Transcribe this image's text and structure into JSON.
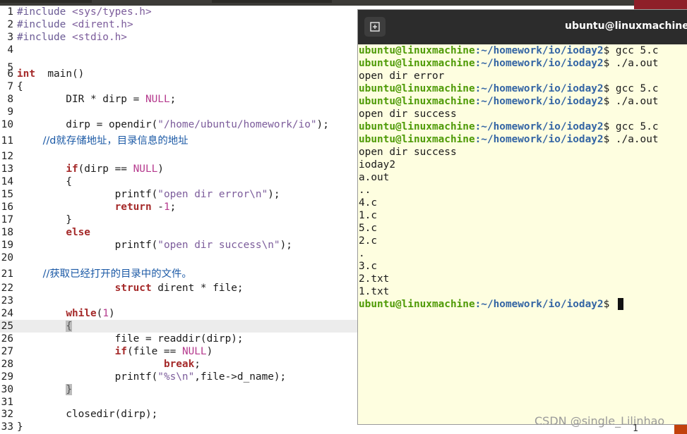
{
  "editor": {
    "lines": [
      {
        "n": "1",
        "parts": [
          [
            "pp",
            "#include "
          ],
          [
            "str",
            "<sys/types.h>"
          ]
        ]
      },
      {
        "n": "2",
        "parts": [
          [
            "pp",
            "#include "
          ],
          [
            "str",
            "<dirent.h>"
          ]
        ]
      },
      {
        "n": "3",
        "parts": [
          [
            "pp",
            "#include "
          ],
          [
            "str",
            "<stdio.h>"
          ]
        ]
      },
      {
        "n": "4",
        "parts": []
      },
      {
        "n": "5",
        "parts": []
      },
      {
        "n": "6",
        "parts": [
          [
            "kw",
            "int"
          ],
          [
            "",
            "  main()"
          ]
        ]
      },
      {
        "n": "7",
        "parts": [
          [
            "",
            "{"
          ]
        ]
      },
      {
        "n": "8",
        "parts": [
          [
            "",
            "        DIR * dirp = "
          ],
          [
            "num",
            "NULL"
          ],
          [
            "",
            ";"
          ]
        ]
      },
      {
        "n": "9",
        "parts": []
      },
      {
        "n": "10",
        "parts": [
          [
            "",
            "        dirp = opendir("
          ],
          [
            "str",
            "\"/home/ubuntu/homework/io\""
          ],
          [
            "",
            ");"
          ]
        ]
      },
      {
        "n": "11",
        "parts": [
          [
            "cmt",
            "        //d就存储地址，目录信息的地址"
          ]
        ]
      },
      {
        "n": "12",
        "parts": []
      },
      {
        "n": "13",
        "parts": [
          [
            "",
            "        "
          ],
          [
            "kw",
            "if"
          ],
          [
            "",
            "(dirp == "
          ],
          [
            "num",
            "NULL"
          ],
          [
            "",
            ")"
          ]
        ]
      },
      {
        "n": "14",
        "parts": [
          [
            "",
            "        {"
          ]
        ]
      },
      {
        "n": "15",
        "parts": [
          [
            "",
            "                printf("
          ],
          [
            "str",
            "\"open dir error\\n\""
          ],
          [
            "",
            ");"
          ]
        ]
      },
      {
        "n": "16",
        "parts": [
          [
            "",
            "                "
          ],
          [
            "kw",
            "return"
          ],
          [
            "",
            " -"
          ],
          [
            "num",
            "1"
          ],
          [
            "",
            ";"
          ]
        ]
      },
      {
        "n": "17",
        "parts": [
          [
            "",
            "        }"
          ]
        ]
      },
      {
        "n": "18",
        "parts": [
          [
            "",
            "        "
          ],
          [
            "kw",
            "else"
          ]
        ]
      },
      {
        "n": "19",
        "parts": [
          [
            "",
            "                printf("
          ],
          [
            "str",
            "\"open dir success\\n\""
          ],
          [
            "",
            ");"
          ]
        ]
      },
      {
        "n": "20",
        "parts": []
      },
      {
        "n": "21",
        "parts": [
          [
            "cmt",
            "        //获取已经打开的目录中的文件。"
          ]
        ]
      },
      {
        "n": "22",
        "parts": [
          [
            "",
            "                "
          ],
          [
            "kw",
            "struct"
          ],
          [
            "",
            " dirent * file;"
          ]
        ]
      },
      {
        "n": "23",
        "parts": []
      },
      {
        "n": "24",
        "parts": [
          [
            "",
            "        "
          ],
          [
            "kw",
            "while"
          ],
          [
            "",
            "("
          ],
          [
            "num",
            "1"
          ],
          [
            "",
            ")"
          ]
        ]
      },
      {
        "n": "25",
        "parts": [
          [
            "",
            "        "
          ],
          [
            "brace-hl",
            "{"
          ]
        ],
        "current": true
      },
      {
        "n": "26",
        "parts": [
          [
            "",
            "                file = readdir(dirp);"
          ]
        ]
      },
      {
        "n": "27",
        "parts": [
          [
            "",
            "                "
          ],
          [
            "kw",
            "if"
          ],
          [
            "",
            "(file == "
          ],
          [
            "num",
            "NULL"
          ],
          [
            "",
            ")"
          ]
        ]
      },
      {
        "n": "28",
        "parts": [
          [
            "",
            "                        "
          ],
          [
            "kw",
            "break"
          ],
          [
            "",
            ";"
          ]
        ]
      },
      {
        "n": "29",
        "parts": [
          [
            "",
            "                printf("
          ],
          [
            "str",
            "\"%s\\n\""
          ],
          [
            "",
            ",file->d_name);"
          ]
        ]
      },
      {
        "n": "30",
        "parts": [
          [
            "",
            "        "
          ],
          [
            "brace-hl",
            "}"
          ]
        ]
      },
      {
        "n": "31",
        "parts": []
      },
      {
        "n": "32",
        "parts": [
          [
            "",
            "        closedir(dirp);"
          ]
        ]
      },
      {
        "n": "33",
        "parts": [
          [
            "",
            "}"
          ]
        ]
      }
    ]
  },
  "terminal": {
    "title": "ubuntu@linuxmachine: ~",
    "prompt_user": "ubuntu@linuxmachine",
    "prompt_path": ":~/homework/io/ioday2",
    "prompt_end": "$ ",
    "lines": [
      {
        "type": "cmd",
        "text": "gcc 5.c"
      },
      {
        "type": "cmd",
        "text": "./a.out"
      },
      {
        "type": "out",
        "text": "open dir error"
      },
      {
        "type": "cmd",
        "text": "gcc 5.c"
      },
      {
        "type": "cmd",
        "text": "./a.out"
      },
      {
        "type": "out",
        "text": "open dir success"
      },
      {
        "type": "cmd",
        "text": "gcc 5.c"
      },
      {
        "type": "cmd",
        "text": "./a.out"
      },
      {
        "type": "out",
        "text": "open dir success"
      },
      {
        "type": "out",
        "text": "ioday2"
      },
      {
        "type": "out",
        "text": "a.out"
      },
      {
        "type": "out",
        "text": ".."
      },
      {
        "type": "out",
        "text": "4.c"
      },
      {
        "type": "out",
        "text": "1.c"
      },
      {
        "type": "out",
        "text": "5.c"
      },
      {
        "type": "out",
        "text": "2.c"
      },
      {
        "type": "out",
        "text": "."
      },
      {
        "type": "out",
        "text": "3.c"
      },
      {
        "type": "out",
        "text": "2.txt"
      },
      {
        "type": "out",
        "text": "1.txt"
      },
      {
        "type": "prompt",
        "text": ""
      }
    ]
  },
  "status_number": "1",
  "watermark": "CSDN @single_Lilinhao",
  "colors": {
    "prompt_user": "#4e9a06",
    "prompt_path": "#3465a4",
    "terminal_bg": "#fefee0",
    "keyword": "#a52a2a"
  }
}
